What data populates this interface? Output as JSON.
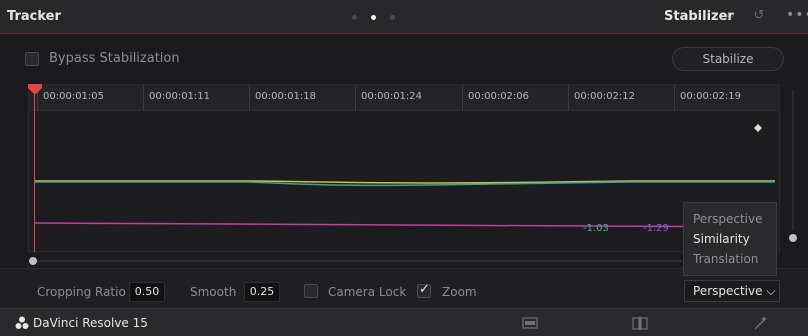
{
  "header": {
    "title": "Tracker",
    "mode": "Stabilizer",
    "chevron": "⌵",
    "reset_icon": "↺",
    "more_icon": "•••"
  },
  "bypass": {
    "label": "Bypass Stabilization",
    "checked": false
  },
  "stabilize_button": "Stabilize",
  "ruler": {
    "timecodes": [
      "00:00:01:05",
      "00:00:01:11",
      "00:00:01:18",
      "00:00:01:24",
      "00:00:02:06",
      "00:00:02:12",
      "00:00:02:19"
    ]
  },
  "graph": {
    "values": [
      {
        "text": "-1.03",
        "color": "#3cb88a"
      },
      {
        "text": "-1.29",
        "color": "#8c5ad6"
      }
    ],
    "colors": {
      "playhead": "#e14a44",
      "yellow": "#c9c43a",
      "teal": "#3aa0a6",
      "magenta": "#c23fa6"
    }
  },
  "menu": {
    "items": [
      {
        "label": "Perspective",
        "active": false
      },
      {
        "label": "Similarity",
        "active": true
      },
      {
        "label": "Translation",
        "active": false
      }
    ]
  },
  "controls": {
    "cropping_ratio_label": "Cropping Ratio",
    "cropping_ratio_value": "0.50",
    "smooth_label": "Smooth",
    "smooth_value": "0.25",
    "camera_lock_label": "Camera Lock",
    "zoom_label": "Zoom",
    "zoom_checked": true,
    "mode_dropdown": "Perspective ⌵"
  },
  "footer": {
    "app_name": "DaVinci Resolve 15",
    "icons": [
      "media-icon",
      "split-icon",
      "magic-wand-icon"
    ]
  }
}
